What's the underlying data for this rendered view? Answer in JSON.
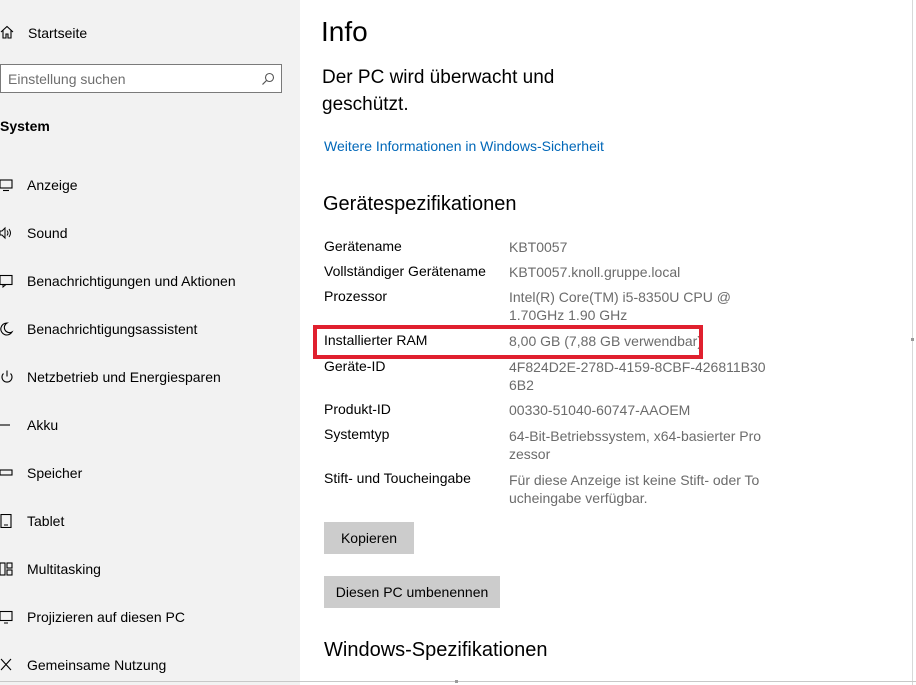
{
  "sidebar": {
    "home_label": "Startseite",
    "search_placeholder": "Einstellung suchen",
    "section_title": "System",
    "items": [
      {
        "label": "Anzeige",
        "icon": "display-icon"
      },
      {
        "label": "Sound",
        "icon": "speaker-icon"
      },
      {
        "label": "Benachrichtigungen und Aktionen",
        "icon": "notification-icon"
      },
      {
        "label": "Benachrichtigungsassistent",
        "icon": "moon-icon"
      },
      {
        "label": "Netzbetrieb und Energiesparen",
        "icon": "power-icon"
      },
      {
        "label": "Akku",
        "icon": "battery-icon"
      },
      {
        "label": "Speicher",
        "icon": "storage-icon"
      },
      {
        "label": "Tablet",
        "icon": "tablet-icon"
      },
      {
        "label": "Multitasking",
        "icon": "multitasking-icon"
      },
      {
        "label": "Projizieren auf diesen PC",
        "icon": "project-icon"
      },
      {
        "label": "Gemeinsame Nutzung",
        "icon": "share-icon"
      }
    ]
  },
  "main": {
    "title": "Info",
    "status": "Der PC wird überwacht und geschützt.",
    "security_link": "Weitere Informationen in Windows-Sicherheit",
    "specs_heading": "Gerätespezifikationen",
    "specs": [
      {
        "label": "Gerätename",
        "value": "KBT0057"
      },
      {
        "label": "Vollständiger Gerätename",
        "value": "KBT0057.knoll.gruppe.local"
      },
      {
        "label": "Prozessor",
        "value": "Intel(R) Core(TM) i5-8350U CPU @ 1.70GHz   1.90 GHz"
      },
      {
        "label": "Installierter RAM",
        "value": "8,00 GB (7,88 GB verwendbar)"
      },
      {
        "label": "Geräte-ID",
        "value": "4F824D2E-278D-4159-8CBF-426811B306B2"
      },
      {
        "label": "Produkt-ID",
        "value": "00330-51040-60747-AAOEM"
      },
      {
        "label": "Systemtyp",
        "value": "64-Bit-Betriebssystem, x64-basierter Prozessor"
      },
      {
        "label": "Stift- und Toucheingabe",
        "value": "Für diese Anzeige ist keine Stift- oder Toucheingabe verfügbar."
      }
    ],
    "copy_button": "Kopieren",
    "rename_button": "Diesen PC umbenennen",
    "windows_heading": "Windows-Spezifikationen"
  },
  "colors": {
    "sidebar_bg": "#f2f2f2",
    "link": "#0067b8",
    "highlight": "#e0202e",
    "button_bg": "#cccccc",
    "value_text": "#6b6b6b"
  }
}
